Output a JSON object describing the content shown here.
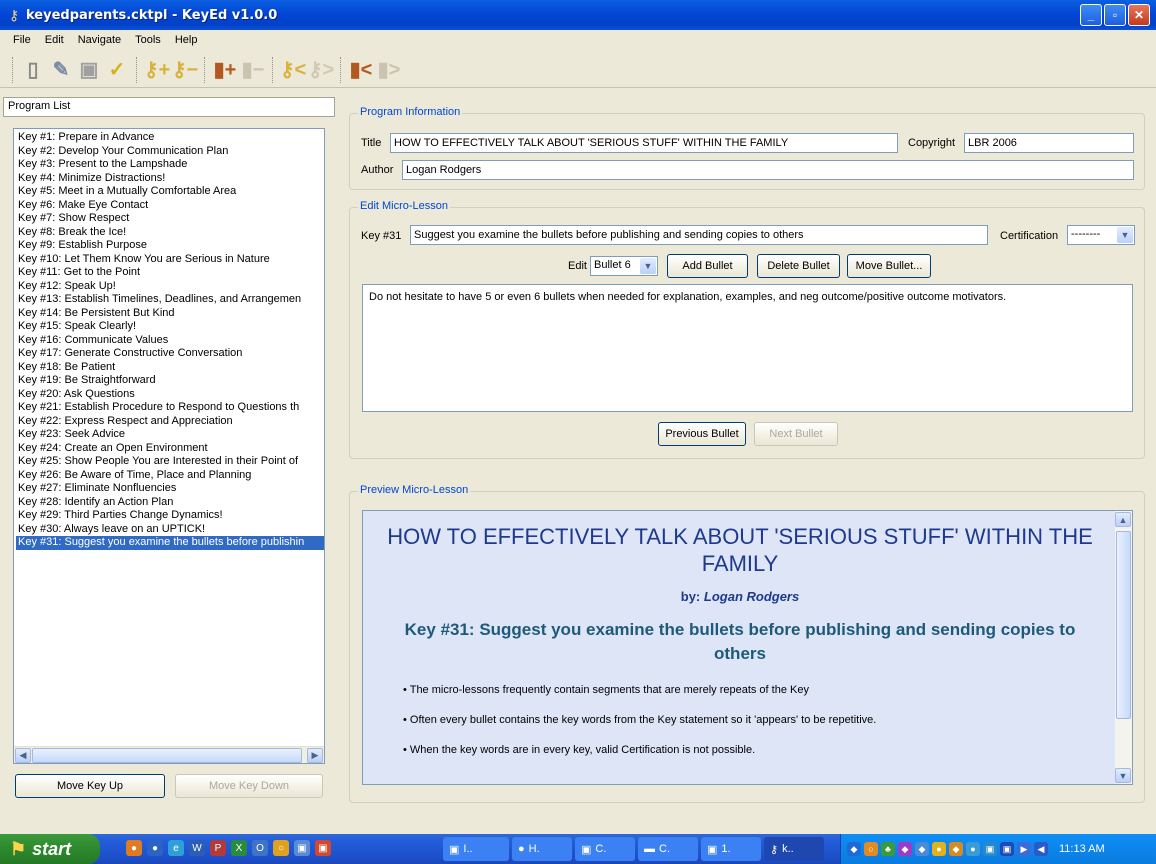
{
  "window": {
    "title": "keyedparents.cktpl - KeyEd v1.0.0",
    "minimize": "_",
    "maximize": "▫",
    "close": "✕"
  },
  "menu": [
    "File",
    "Edit",
    "Navigate",
    "Tools",
    "Help"
  ],
  "toolbar": {
    "icons": [
      "new-document-icon",
      "open-pencil-icon",
      "save-icon",
      "validate-check-icon",
      "add-key-icon",
      "remove-key-icon",
      "add-bullet-icon",
      "remove-bullet-icon",
      "previous-key-icon",
      "next-key-icon",
      "first-bullet-icon",
      "last-bullet-icon"
    ]
  },
  "program_list": {
    "header": "Program List",
    "items": [
      "Key #1: Prepare in Advance",
      "Key #2: Develop Your Communication Plan",
      "Key #3: Present to the Lampshade",
      "Key #4: Minimize Distractions!",
      "Key #5: Meet in a Mutually Comfortable Area",
      "Key #6: Make Eye Contact",
      "Key #7: Show Respect",
      "Key #8: Break the Ice!",
      "Key #9: Establish Purpose",
      "Key #10: Let Them Know You are Serious in Nature",
      "Key #11: Get to the Point",
      "Key #12: Speak Up!",
      "Key #13: Establish Timelines, Deadlines, and Arrangemen",
      "Key #14: Be Persistent But Kind",
      "Key #15: Speak Clearly!",
      "Key #16: Communicate Values",
      "Key #17: Generate Constructive Conversation",
      "Key #18: Be Patient",
      "Key #19: Be Straightforward",
      "Key #20: Ask Questions",
      "Key #21: Establish Procedure to Respond to Questions th",
      "Key #22: Express Respect and Appreciation",
      "Key #23: Seek Advice",
      "Key #24: Create an Open Environment",
      "Key #25: Show People You are Interested in their Point of",
      "Key #26: Be Aware of Time, Place and Planning",
      "Key #27: Eliminate Nonfluencies",
      "Key #28: Identify an Action Plan",
      "Key #29: Third Parties Change Dynamics!",
      "Key #30: Always leave on an UPTICK!",
      "Key #31: Suggest you examine the bullets before publishin"
    ],
    "selected_index": 30,
    "move_up": "Move Key Up",
    "move_down": "Move Key Down"
  },
  "program_info": {
    "group_label": "Program Information",
    "title_label": "Title",
    "title_value": "HOW TO EFFECTIVELY TALK ABOUT 'SERIOUS STUFF' WITHIN THE FAMILY",
    "copyright_label": "Copyright",
    "copyright_value": "LBR 2006",
    "author_label": "Author",
    "author_value": "Logan Rodgers"
  },
  "edit_lesson": {
    "group_label": "Edit Micro-Lesson",
    "key_label": "Key #31",
    "key_value": "Suggest you examine the bullets before publishing and sending copies to others",
    "certification_label": "Certification",
    "certification_value": "--------",
    "edit_label": "Edit",
    "bullet_select": "Bullet 6",
    "add_bullet": "Add Bullet",
    "delete_bullet": "Delete Bullet",
    "move_bullet": "Move Bullet...",
    "bullet_text": "Do not hesitate to have 5 or even 6 bullets when needed for explanation, examples, and neg outcome/positive outcome motivators.",
    "previous_bullet": "Previous Bullet",
    "next_bullet": "Next Bullet"
  },
  "preview": {
    "group_label": "Preview Micro-Lesson",
    "title": "HOW TO EFFECTIVELY TALK ABOUT 'SERIOUS STUFF' WITHIN THE FAMILY",
    "by_label": "by:",
    "author": "Logan Rodgers",
    "key_heading": "Key #31: Suggest you examine the bullets before publishing and sending copies to others",
    "bullets": [
      "The micro-lessons frequently contain segments that are merely repeats of the Key",
      "Often every bullet contains the key words from the Key statement so it 'appears' to be repetitive.",
      "When the key words are in every key, valid Certification is not possible."
    ]
  },
  "taskbar": {
    "start": "start",
    "tasks": [
      "I..",
      "H.",
      "C.",
      "C.",
      "1.",
      "k.."
    ],
    "clock": "11:13 AM"
  }
}
